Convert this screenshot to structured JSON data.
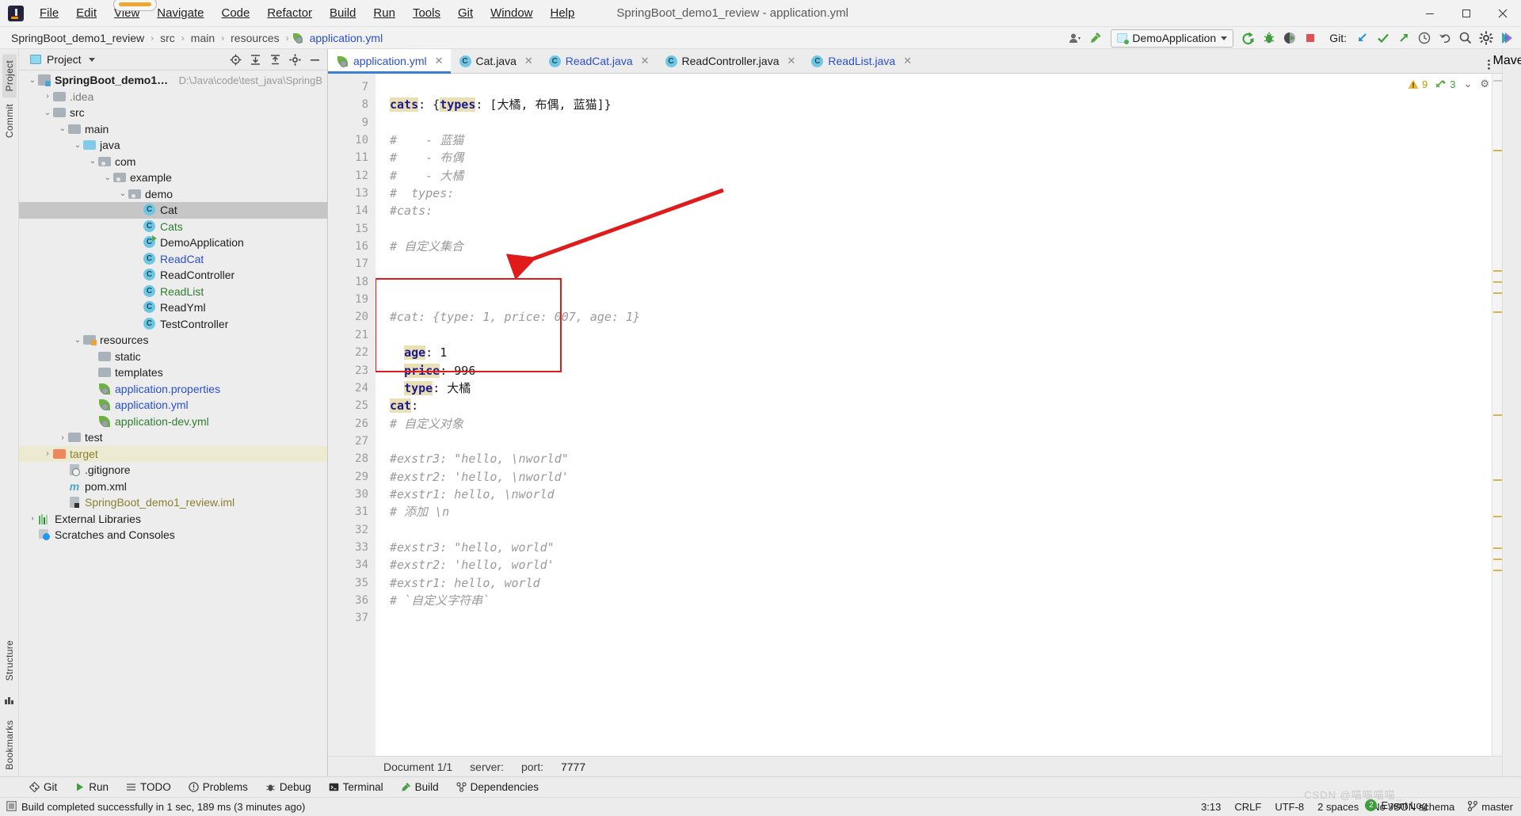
{
  "window": {
    "title": "SpringBoot_demo1_review - application.yml",
    "minimize": "─",
    "maximize": "❐",
    "close": "✕"
  },
  "menu": {
    "items": [
      "File",
      "Edit",
      "View",
      "Navigate",
      "Code",
      "Refactor",
      "Build",
      "Run",
      "Tools",
      "Git",
      "Window",
      "Help"
    ]
  },
  "breadcrumb": {
    "items": [
      "SpringBoot_demo1_review",
      "src",
      "main",
      "resources",
      "application.yml"
    ],
    "separator": "›"
  },
  "toolbar": {
    "run_config": "DemoApplication",
    "git_label": "Git:",
    "icons": [
      "user-avatar-icon",
      "hammer-build-icon",
      "run-icon",
      "debug-icon",
      "run-coverage-icon",
      "stop-icon",
      "git-update-icon",
      "git-commit-icon",
      "git-push-icon",
      "history-icon",
      "undo-icon",
      "search-everywhere-icon",
      "settings-gear-icon",
      "ide-assistant-icon"
    ]
  },
  "project_panel": {
    "title": "Project",
    "header_icons": [
      "locate-icon",
      "expand-all-icon",
      "collapse-all-icon",
      "settings-icon",
      "hide-icon"
    ],
    "tree": [
      {
        "label": "SpringBoot_demo1_review",
        "path": "D:\\Java\\code\\test_java\\SpringB",
        "depth": 0,
        "twist": "v",
        "icon": "project-folder",
        "style": "root"
      },
      {
        "label": ".idea",
        "depth": 1,
        "twist": ">",
        "icon": "folder",
        "style": "dim"
      },
      {
        "label": "src",
        "depth": 1,
        "twist": "v",
        "icon": "folder"
      },
      {
        "label": "main",
        "depth": 2,
        "twist": "v",
        "icon": "folder"
      },
      {
        "label": "java",
        "depth": 3,
        "twist": "v",
        "icon": "folder-source"
      },
      {
        "label": "com",
        "depth": 4,
        "twist": "v",
        "icon": "folder-package"
      },
      {
        "label": "example",
        "depth": 5,
        "twist": "v",
        "icon": "folder-package"
      },
      {
        "label": "demo",
        "depth": 6,
        "twist": "v",
        "icon": "folder-package"
      },
      {
        "label": "Cat",
        "depth": 7,
        "icon": "class",
        "selected": true
      },
      {
        "label": "Cats",
        "depth": 7,
        "icon": "class",
        "style": "green"
      },
      {
        "label": "DemoApplication",
        "depth": 7,
        "icon": "class-runnable"
      },
      {
        "label": "ReadCat",
        "depth": 7,
        "icon": "class",
        "style": "blue"
      },
      {
        "label": "ReadController",
        "depth": 7,
        "icon": "class"
      },
      {
        "label": "ReadList",
        "depth": 7,
        "icon": "class",
        "style": "green"
      },
      {
        "label": "ReadYml",
        "depth": 7,
        "icon": "class"
      },
      {
        "label": "TestController",
        "depth": 7,
        "icon": "class"
      },
      {
        "label": "resources",
        "depth": 3,
        "twist": "v",
        "icon": "folder-resource"
      },
      {
        "label": "static",
        "depth": 4,
        "icon": "folder"
      },
      {
        "label": "templates",
        "depth": 4,
        "icon": "folder"
      },
      {
        "label": "application.properties",
        "depth": 4,
        "icon": "spring-leaf",
        "style": "blue"
      },
      {
        "label": "application.yml",
        "depth": 4,
        "icon": "spring-leaf",
        "style": "blue"
      },
      {
        "label": "application-dev.yml",
        "depth": 4,
        "icon": "spring-leaf",
        "style": "green"
      },
      {
        "label": "test",
        "depth": 2,
        "twist": ">",
        "icon": "folder"
      },
      {
        "label": "target",
        "depth": 1,
        "twist": ">",
        "icon": "folder-excluded",
        "style": "olive",
        "highlight": true
      },
      {
        "label": ".gitignore",
        "depth": 2,
        "icon": "file-ignored"
      },
      {
        "label": "pom.xml",
        "depth": 2,
        "icon": "maven"
      },
      {
        "label": "SpringBoot_demo1_review.iml",
        "depth": 2,
        "icon": "file-iml",
        "style": "olive"
      },
      {
        "label": "External Libraries",
        "depth": 0,
        "twist": ">",
        "icon": "libraries"
      },
      {
        "label": "Scratches and Consoles",
        "depth": 0,
        "icon": "scratches"
      }
    ]
  },
  "left_strip": {
    "tabs": [
      "Project",
      "Commit",
      "Structure",
      "Bookmarks"
    ]
  },
  "right_strip": {
    "tabs": [
      "Maven"
    ]
  },
  "editor": {
    "tabs": [
      {
        "label": "application.yml",
        "icon": "spring-leaf",
        "active": true,
        "color": "blue"
      },
      {
        "label": "Cat.java",
        "icon": "class"
      },
      {
        "label": "ReadCat.java",
        "icon": "class",
        "color": "blue"
      },
      {
        "label": "ReadController.java",
        "icon": "class"
      },
      {
        "label": "ReadList.java",
        "icon": "class",
        "color": "blue"
      }
    ],
    "inspections": {
      "warnings": "9",
      "weak": "3"
    },
    "first_line_number": 7,
    "lines": [
      {
        "n": 7,
        "segments": []
      },
      {
        "n": 8,
        "segments": [
          {
            "t": "# `自定义字符串`",
            "c": "comment"
          }
        ]
      },
      {
        "n": 9,
        "segments": [
          {
            "t": "#exstr1: hello, world",
            "c": "comment"
          }
        ]
      },
      {
        "n": 10,
        "segments": [
          {
            "t": "#exstr2: 'hello, world'",
            "c": "comment"
          }
        ]
      },
      {
        "n": 11,
        "segments": [
          {
            "t": "#exstr3: \"hello, world\"",
            "c": "comment"
          }
        ]
      },
      {
        "n": 12,
        "segments": []
      },
      {
        "n": 13,
        "segments": [
          {
            "t": "# 添加 \\n",
            "c": "comment"
          }
        ]
      },
      {
        "n": 14,
        "segments": [
          {
            "t": "#exstr1: hello, \\nworld",
            "c": "comment"
          }
        ]
      },
      {
        "n": 15,
        "segments": [
          {
            "t": "#exstr2: 'hello, \\nworld'",
            "c": "comment"
          }
        ]
      },
      {
        "n": 16,
        "segments": [
          {
            "t": "#exstr3: \"hello, \\nworld\"",
            "c": "comment"
          }
        ]
      },
      {
        "n": 17,
        "segments": []
      },
      {
        "n": 18,
        "segments": [
          {
            "t": "# 自定义对象",
            "c": "comment"
          }
        ]
      },
      {
        "n": 19,
        "segments": [
          {
            "t": "cat",
            "c": "key-hl"
          },
          {
            "t": ":",
            "c": "plain"
          }
        ]
      },
      {
        "n": 20,
        "segments": [
          {
            "t": "  ",
            "c": "plain"
          },
          {
            "t": "type",
            "c": "key-hl"
          },
          {
            "t": ": 大橘",
            "c": "plain"
          }
        ]
      },
      {
        "n": 21,
        "segments": [
          {
            "t": "  ",
            "c": "plain"
          },
          {
            "t": "price",
            "c": "key-hl"
          },
          {
            "t": ": 996",
            "c": "plain"
          }
        ]
      },
      {
        "n": 22,
        "segments": [
          {
            "t": "  ",
            "c": "plain"
          },
          {
            "t": "age",
            "c": "key-hl"
          },
          {
            "t": ": 1",
            "c": "plain"
          }
        ]
      },
      {
        "n": 23,
        "segments": []
      },
      {
        "n": 24,
        "segments": [
          {
            "t": "#cat: {type: 1, price: 007, age: 1}",
            "c": "comment"
          }
        ]
      },
      {
        "n": 25,
        "segments": []
      },
      {
        "n": 26,
        "segments": []
      },
      {
        "n": 27,
        "segments": []
      },
      {
        "n": 28,
        "segments": [
          {
            "t": "# 自定义集合",
            "c": "comment"
          }
        ]
      },
      {
        "n": 29,
        "segments": []
      },
      {
        "n": 30,
        "segments": [
          {
            "t": "#cats:",
            "c": "comment"
          }
        ]
      },
      {
        "n": 31,
        "segments": [
          {
            "t": "#  types:",
            "c": "comment"
          }
        ]
      },
      {
        "n": 32,
        "segments": [
          {
            "t": "#    - 大橘",
            "c": "comment"
          }
        ]
      },
      {
        "n": 33,
        "segments": [
          {
            "t": "#    - 布偶",
            "c": "comment"
          }
        ]
      },
      {
        "n": 34,
        "segments": [
          {
            "t": "#    - 蓝猫",
            "c": "comment"
          }
        ]
      },
      {
        "n": 35,
        "segments": []
      },
      {
        "n": 36,
        "segments": [
          {
            "t": "cats",
            "c": "key-hl"
          },
          {
            "t": ": {",
            "c": "plain"
          },
          {
            "t": "types",
            "c": "key-hl"
          },
          {
            "t": ": [大橘, 布偶, 蓝猫]}",
            "c": "plain"
          }
        ]
      },
      {
        "n": 37,
        "segments": []
      }
    ]
  },
  "editor_status": {
    "document": "Document 1/1",
    "server_label": "server:",
    "port_label": "port:",
    "port_value": "7777"
  },
  "tool_windows": [
    {
      "label": "Git",
      "icon": "git-icon"
    },
    {
      "label": "Run",
      "icon": "run-icon"
    },
    {
      "label": "TODO",
      "icon": "todo-icon"
    },
    {
      "label": "Problems",
      "icon": "problems-icon"
    },
    {
      "label": "Debug",
      "icon": "debug-icon"
    },
    {
      "label": "Terminal",
      "icon": "terminal-icon"
    },
    {
      "label": "Build",
      "icon": "build-icon"
    },
    {
      "label": "Dependencies",
      "icon": "dependencies-icon"
    }
  ],
  "status_bar": {
    "message": "Build completed successfully in 1 sec, 189 ms (3 minutes ago)",
    "event_log": "Event Log",
    "event_count": "2",
    "caret": "3:13",
    "line_sep": "CRLF",
    "encoding": "UTF-8",
    "indent": "2 spaces",
    "schema": "No JSON schema",
    "branch": "master"
  },
  "watermark": "CSDN @喵喵喵喵_"
}
